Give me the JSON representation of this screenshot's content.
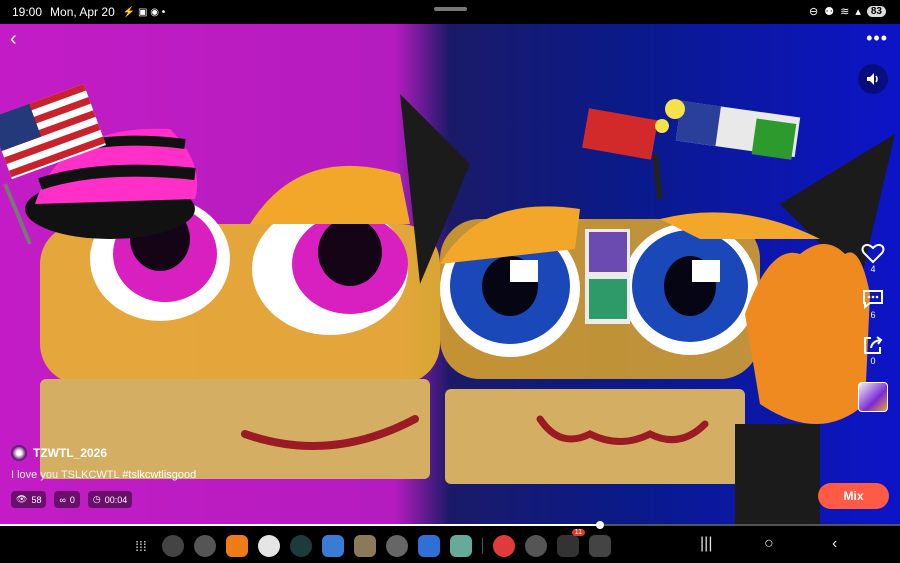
{
  "status_bar": {
    "time": "19:00",
    "date": "Mon, Apr 20",
    "battery": "83"
  },
  "video": {
    "description": "I love you TSLKCWTL #tslkcwtlisgood",
    "flag_label": "",
    "progress_fraction": 0.667
  },
  "topbar": {
    "back_icon": "chevron-left-icon",
    "more_icon": "more-dots-icon",
    "more_glyph": "•••",
    "back_glyph": "‹"
  },
  "author": {
    "username": "TZWTL_2026"
  },
  "caption": {
    "text": "I love you TSLKCWTL ",
    "hashtag": "#tslkcwtlisgood"
  },
  "stats": {
    "views": "58",
    "remixes": "0",
    "duration": "00:04"
  },
  "side_actions": {
    "likes": "4",
    "comments": "6",
    "shares": "0"
  },
  "mix_button": {
    "label": "Mix"
  },
  "taskbar": {
    "apps": [
      "grid-icon",
      "settings-icon",
      "sparkle-icon",
      "fl-studio-icon",
      "diamond-icon",
      "circle-app-icon",
      "picsart-icon",
      "game-icon",
      "arrows-icon",
      "roblox-icon",
      "tower-icon",
      "kinemaster-icon",
      "chrome-icon",
      "flash-icon",
      "window-icon"
    ],
    "flash_badge": "11",
    "nav": {
      "recents": "|||",
      "home": "○",
      "back": "‹"
    }
  },
  "colors": {
    "accent": "#ff5a45",
    "left_bg": "#c31cc6",
    "right_bg": "#0d14c8"
  }
}
